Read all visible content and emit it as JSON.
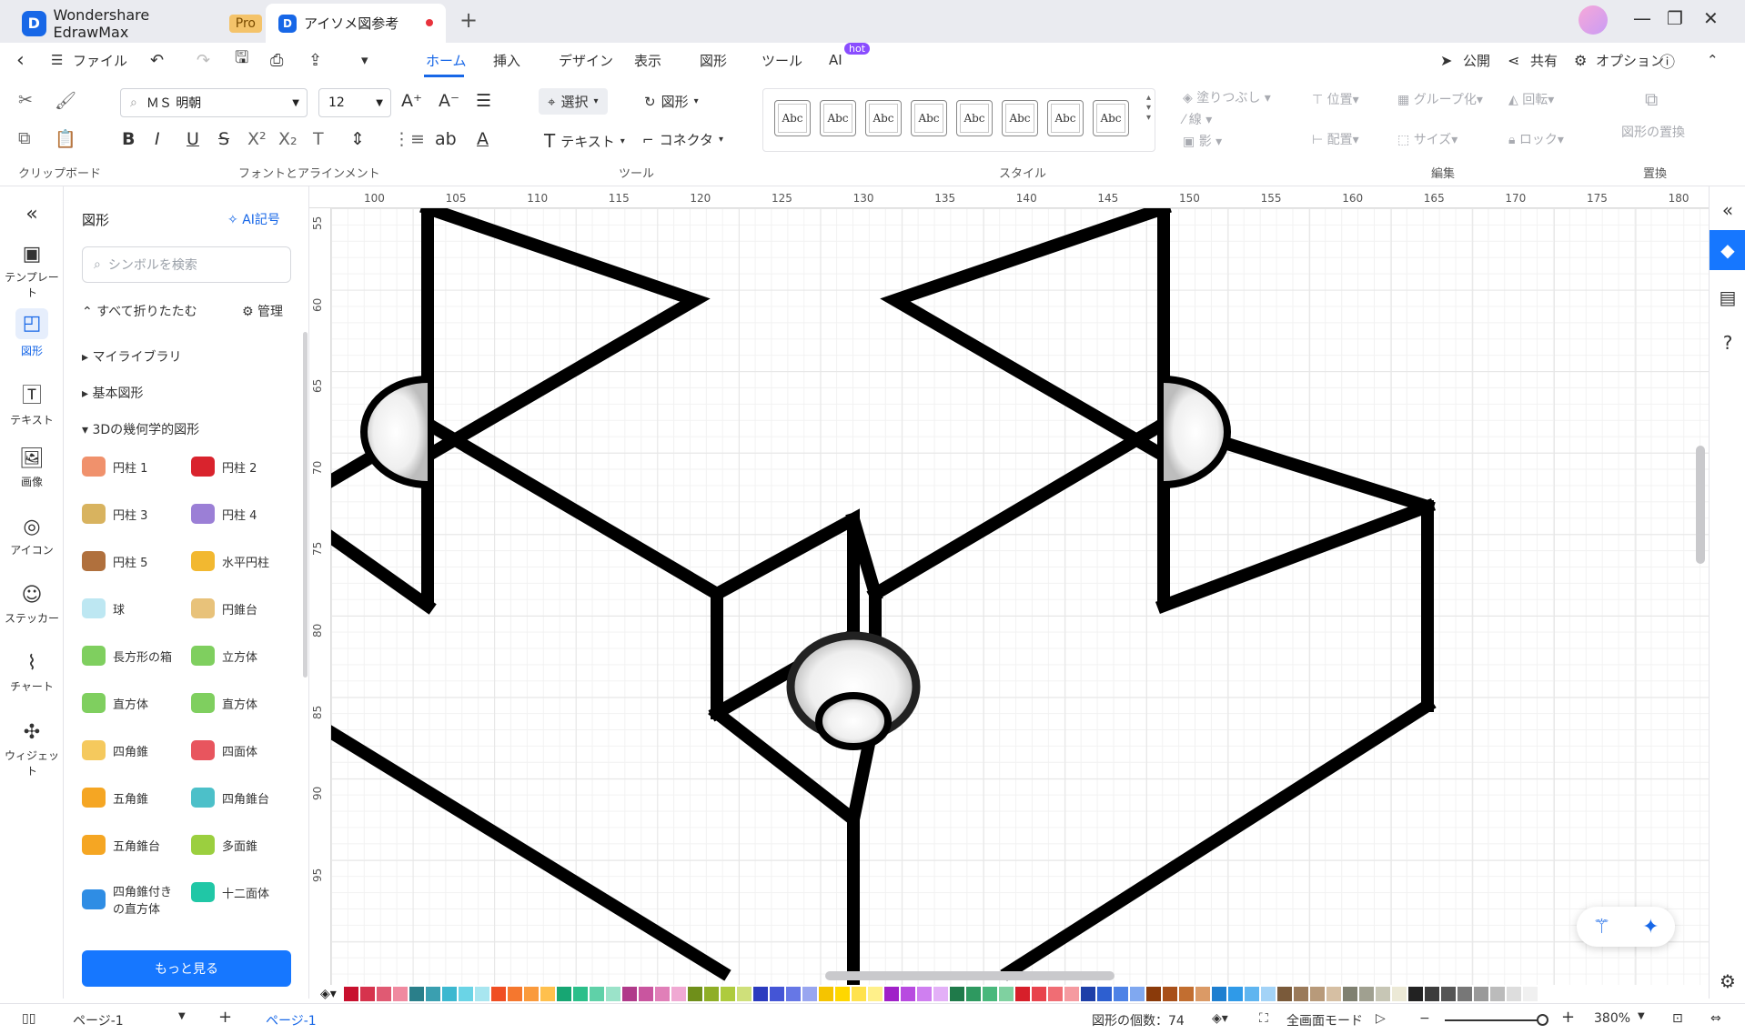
{
  "tabs": {
    "app_name": "Wondershare EdrawMax",
    "pro_badge": "Pro",
    "document_title": "アイソメ図参考"
  },
  "menu": {
    "back": "‹",
    "file": "ファイル",
    "items": [
      "ホーム",
      "挿入",
      "デザイン",
      "表示",
      "図形",
      "ツール",
      "AI"
    ],
    "hot_badge": "hot",
    "publish": "公開",
    "share": "共有",
    "options": "オプション"
  },
  "ribbon": {
    "font_name": "ＭＳ 明朝",
    "font_size": "12",
    "select": "選択",
    "shape": "図形",
    "text": "テキスト",
    "connector": "コネクタ",
    "style_sample": "Abc",
    "fill": "塗りつぶし",
    "line": "線",
    "shadow": "影",
    "position": "位置",
    "group": "グループ化",
    "rotate": "回転",
    "arrange": "配置",
    "size": "サイズ",
    "lock": "ロック",
    "replace_shape": "図形の置換",
    "groups": {
      "clipboard": "クリップボード",
      "font": "フォントとアラインメント",
      "tools": "ツール",
      "style": "スタイル",
      "edit": "編集",
      "replace": "置換"
    }
  },
  "sidebar": {
    "items": [
      "テンプレート",
      "図形",
      "テキスト",
      "画像",
      "アイコン",
      "ステッカー",
      "チャート",
      "ウィジェット"
    ]
  },
  "panel": {
    "title": "図形",
    "ai_symbol": "AI記号",
    "search_placeholder": "シンボルを検索",
    "collapse_all": "すべて折りたたむ",
    "manage": "管理",
    "tree": [
      "マイライブラリ",
      "基本図形",
      "3Dの幾何学的図形"
    ],
    "shapes": [
      {
        "label": "円柱 1",
        "color": "#f0916c"
      },
      {
        "label": "円柱 2",
        "color": "#d9232d"
      },
      {
        "label": "円柱 3",
        "color": "#d8b35f"
      },
      {
        "label": "円柱 4",
        "color": "#9b7fd6"
      },
      {
        "label": "円柱 5",
        "color": "#b0703d"
      },
      {
        "label": "水平円柱",
        "color": "#f2b830"
      },
      {
        "label": "球",
        "color": "#bde7f2"
      },
      {
        "label": "円錐台",
        "color": "#e8c27a"
      },
      {
        "label": "長方形の箱",
        "color": "#7fcf5f"
      },
      {
        "label": "立方体",
        "color": "#7fcf5f"
      },
      {
        "label": "直方体",
        "color": "#7fcf5f"
      },
      {
        "label": "直方体",
        "color": "#7fcf5f"
      },
      {
        "label": "四角錐",
        "color": "#f5c95d"
      },
      {
        "label": "四面体",
        "color": "#e8555e"
      },
      {
        "label": "五角錐",
        "color": "#f5a623"
      },
      {
        "label": "四角錐台",
        "color": "#4cc0c9"
      },
      {
        "label": "五角錐台",
        "color": "#f5a623"
      },
      {
        "label": "多面錐",
        "color": "#9bcf3f"
      },
      {
        "label": "四角錐付き\nの直方体",
        "color": "#2f8de4"
      },
      {
        "label": "十二面体",
        "color": "#20c7a6"
      }
    ],
    "more_button": "もっと見る"
  },
  "ruler": {
    "h": [
      "100",
      "105",
      "110",
      "115",
      "120",
      "125",
      "130",
      "135",
      "140",
      "145",
      "150",
      "155",
      "160",
      "165",
      "170",
      "175",
      "180"
    ],
    "v": [
      "55",
      "60",
      "65",
      "70",
      "75",
      "80",
      "85",
      "90",
      "95"
    ]
  },
  "palette": [
    "#c8102e",
    "#d6334d",
    "#e05a73",
    "#f08aa0",
    "#2a7f8a",
    "#3a9fb0",
    "#3cb8d0",
    "#6ad4e6",
    "#a8e6f0",
    "#f04e23",
    "#f5772e",
    "#fa9a3c",
    "#ffc04d",
    "#17a673",
    "#2bbf8a",
    "#5fd1a8",
    "#9be3c9",
    "#b03a8a",
    "#c9559f",
    "#e07fb8",
    "#f0a9d3",
    "#6f8f1a",
    "#8fae26",
    "#aecb3d",
    "#cfe07a",
    "#2b3bbf",
    "#4455d6",
    "#6677e6",
    "#99a6f0",
    "#f5c400",
    "#ffd700",
    "#ffe24d",
    "#fff08a",
    "#a020c8",
    "#b84ae0",
    "#cf7ff0",
    "#e3b0f7",
    "#1f7a4a",
    "#2e9960",
    "#49b87c",
    "#7fd1a0",
    "#d71f2a",
    "#e8434d",
    "#f06d74",
    "#f59aa0",
    "#1e3fa8",
    "#2d5fd0",
    "#4d82e6",
    "#80a8f0",
    "#8a3a0a",
    "#a8501a",
    "#c26e30",
    "#db9a66",
    "#1e7fd0",
    "#2f9ae8",
    "#5fb5f0",
    "#a3d3f7",
    "#7a5a3a",
    "#9a7a5a",
    "#b89a7a",
    "#d6bfa3",
    "#7f8070",
    "#a0a090",
    "#c7c6b5",
    "#ece9d6",
    "#222222",
    "#3c3c3c",
    "#555555",
    "#777777",
    "#999999",
    "#bbbbbb",
    "#dddddd",
    "#f0f0f0"
  ],
  "status": {
    "page_selector": "ページ-1",
    "page_tab": "ページ-1",
    "shape_count": "図形の個数：74",
    "fullscreen": "全画面モード",
    "zoom": "380%"
  }
}
